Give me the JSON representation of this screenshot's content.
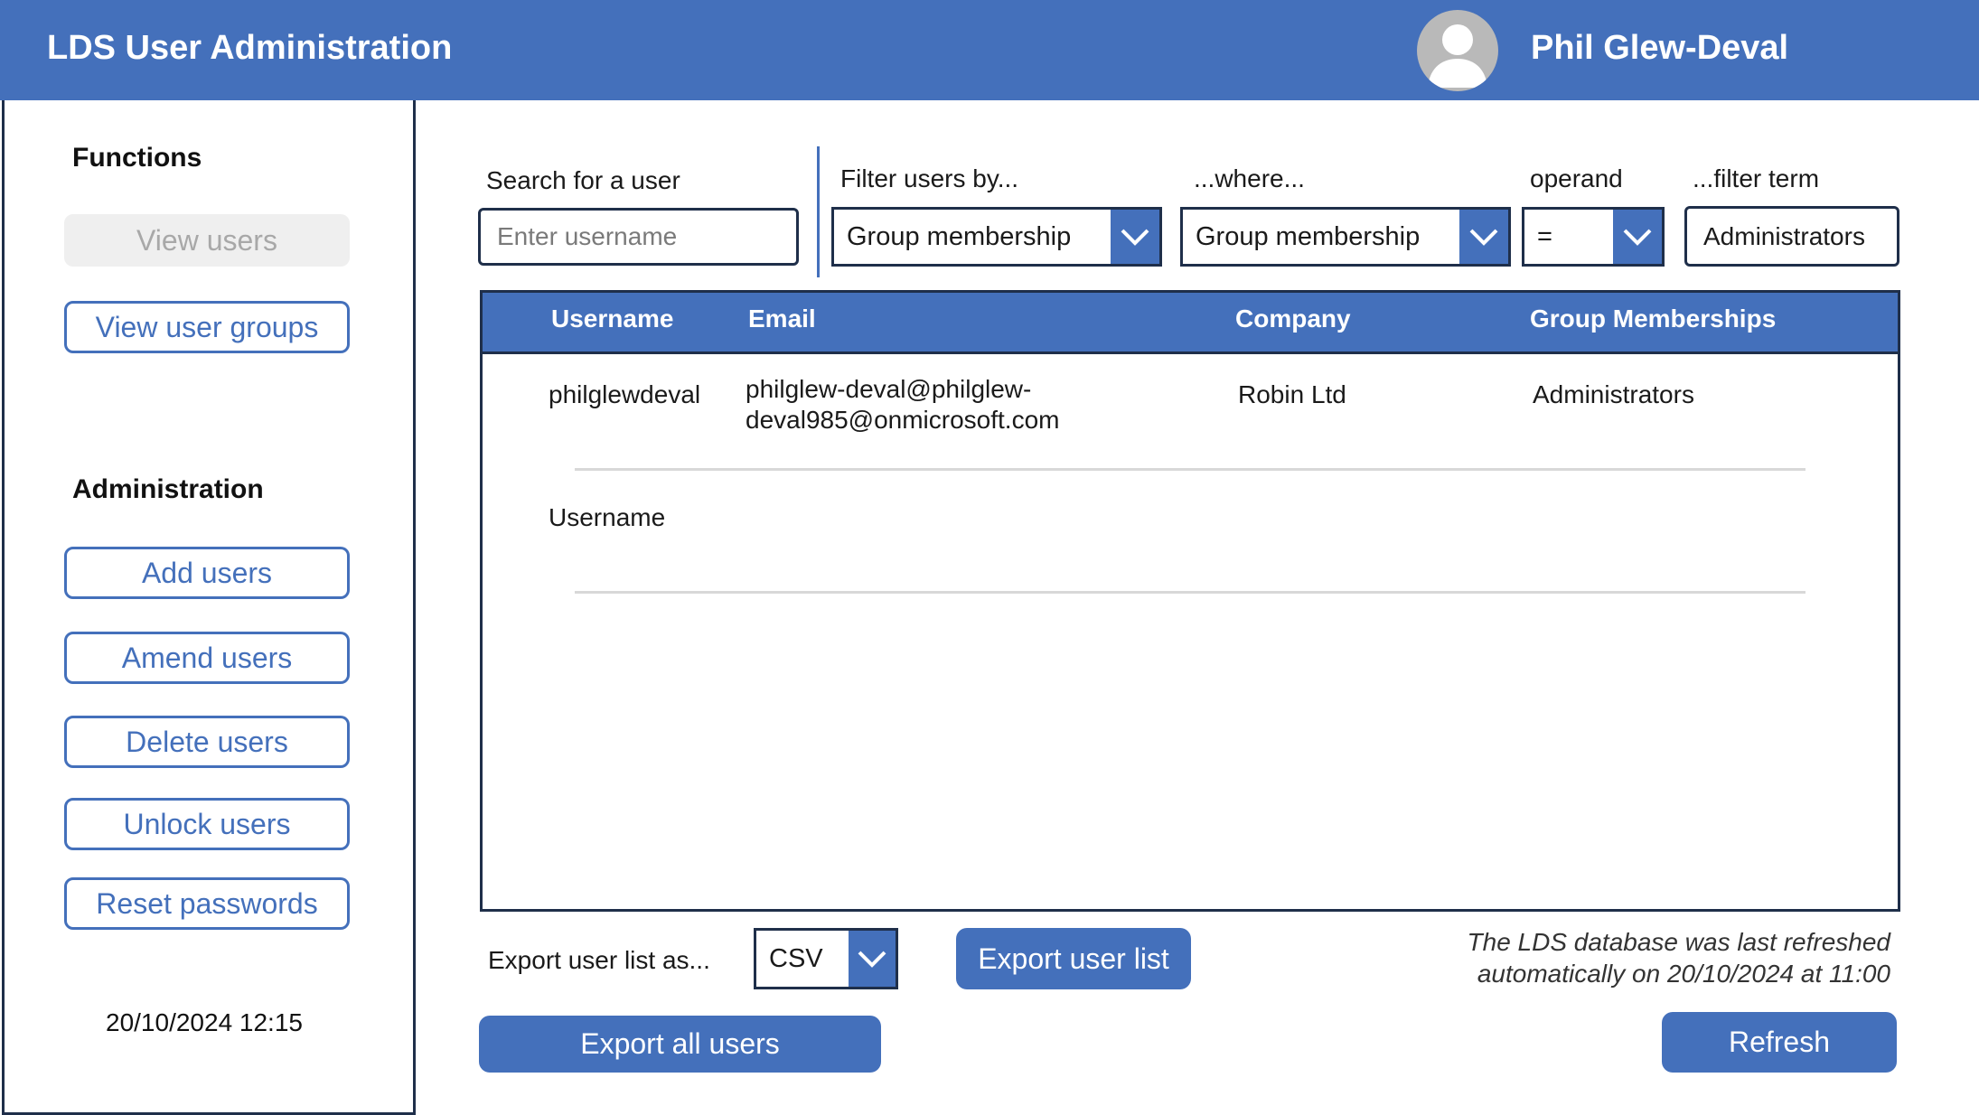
{
  "app": {
    "title": "LDS User Administration"
  },
  "user": {
    "name": "Phil Glew-Deval",
    "avatar_icon": "user-avatar-icon"
  },
  "sidebar": {
    "functions_heading": "Functions",
    "view_users": "View users",
    "view_user_groups": "View user groups",
    "admin_heading": "Administration",
    "add_users": "Add users",
    "amend_users": "Amend users",
    "delete_users": "Delete users",
    "unlock_users": "Unlock users",
    "reset_passwords": "Reset passwords",
    "datetime": "20/10/2024 12:15"
  },
  "search": {
    "label": "Search for a user",
    "placeholder": "Enter username"
  },
  "filters": {
    "filter_by_label": "Filter users by...",
    "filter_by_value": "Group membership",
    "where_label": "...where...",
    "where_value": "Group membership",
    "operand_label": "operand",
    "operand_value": "=",
    "term_label": "...filter term",
    "term_value": "Administrators"
  },
  "table": {
    "columns": [
      "Username",
      "Email",
      "Company",
      "Group Memberships"
    ],
    "rows": [
      {
        "username": "philglewdeval",
        "email_line1": "philglew-deval@philglew-",
        "email_line2": "deval985@onmicrosoft.com",
        "company": "Robin Ltd",
        "groups": "Administrators"
      },
      {
        "username": "Username",
        "email_line1": "",
        "email_line2": "",
        "company": "",
        "groups": ""
      }
    ]
  },
  "export": {
    "label": "Export user list as...",
    "format_value": "CSV",
    "export_list_button": "Export user list",
    "export_all_button": "Export all users"
  },
  "refresh": {
    "note_line1": "The LDS database was last refreshed",
    "note_line2": "automatically on 20/10/2024 at 11:00",
    "button": "Refresh"
  },
  "colors": {
    "accent": "#4470bb",
    "border": "#1f2f4a",
    "disabled_bg": "#efefef"
  }
}
